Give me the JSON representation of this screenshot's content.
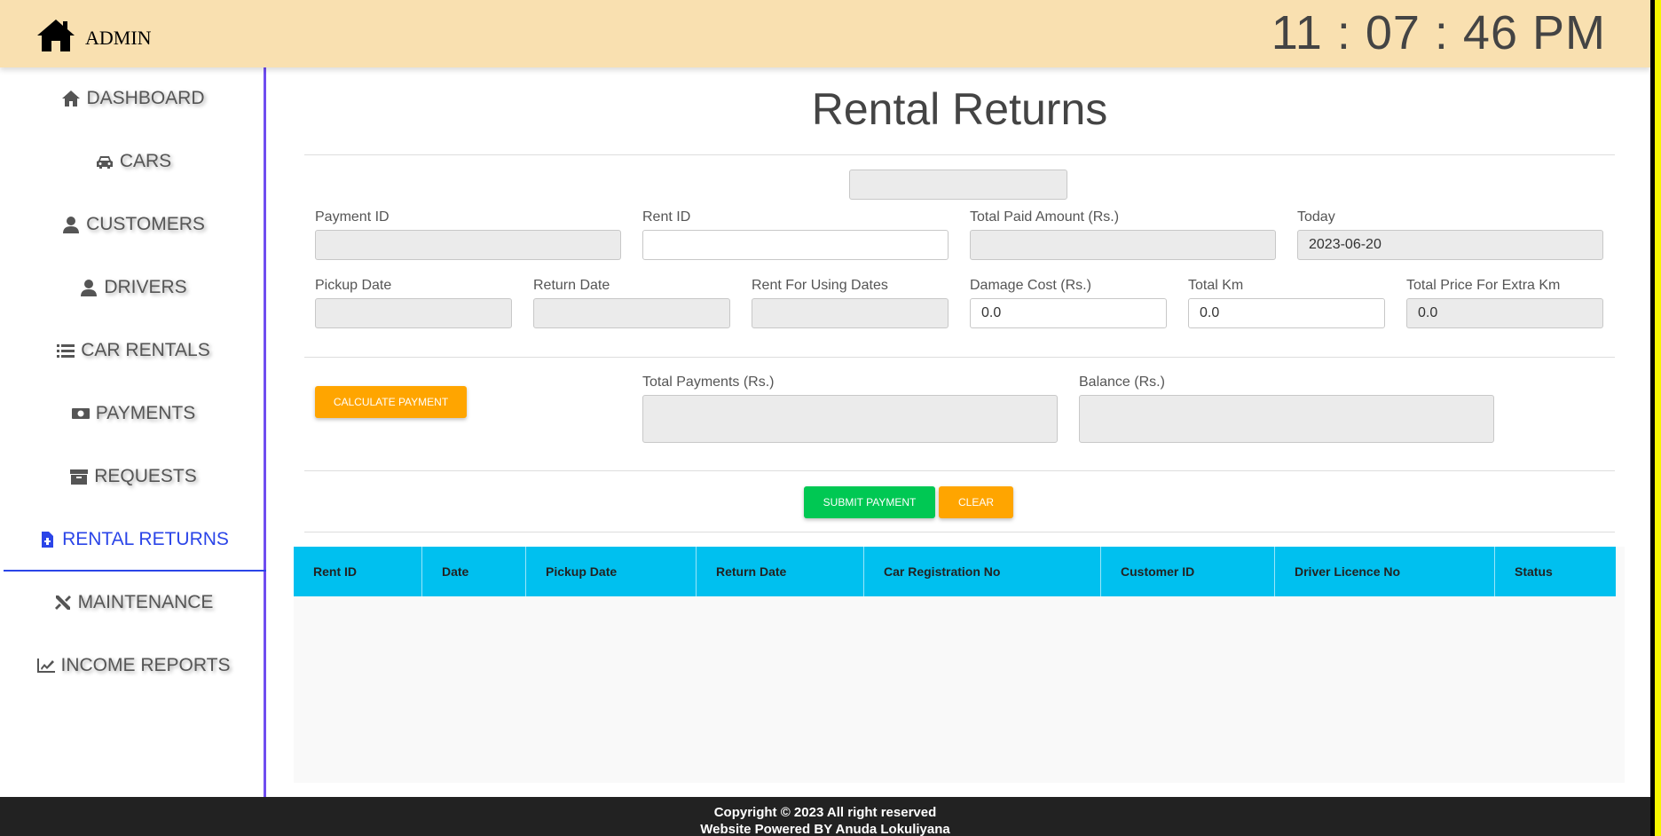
{
  "header": {
    "brand": "ADMIN",
    "clock": "11 : 07 : 46 PM",
    "brand_icon": "home-icon"
  },
  "sidebar": {
    "items": [
      {
        "label": "DASHBOARD",
        "icon": "home-icon"
      },
      {
        "label": "CARS",
        "icon": "car-icon"
      },
      {
        "label": "CUSTOMERS",
        "icon": "user-icon"
      },
      {
        "label": "DRIVERS",
        "icon": "user-icon"
      },
      {
        "label": "CAR RENTALS",
        "icon": "list-icon"
      },
      {
        "label": "PAYMENTS",
        "icon": "money-icon"
      },
      {
        "label": "REQUESTS",
        "icon": "archive-icon"
      },
      {
        "label": "RENTAL RETURNS",
        "icon": "file-invoice-icon",
        "active": true
      },
      {
        "label": "MAINTENANCE",
        "icon": "tools-icon"
      },
      {
        "label": "INCOME REPORTS",
        "icon": "chart-line-icon"
      }
    ],
    "active_color": "#2b45e8"
  },
  "main": {
    "title": "Rental Returns",
    "top_field_value": "",
    "fields": {
      "payment_id": {
        "label": "Payment ID",
        "value": ""
      },
      "rent_id": {
        "label": "Rent ID",
        "value": ""
      },
      "total_paid": {
        "label": "Total Paid Amount (Rs.)",
        "value": ""
      },
      "today": {
        "label": "Today",
        "value": "2023-06-20"
      },
      "pickup_date": {
        "label": "Pickup Date",
        "value": ""
      },
      "return_date": {
        "label": "Return Date",
        "value": ""
      },
      "rent_using_dates": {
        "label": "Rent For Using Dates",
        "value": ""
      },
      "damage_cost": {
        "label": "Damage Cost (Rs.)",
        "value": "0.0"
      },
      "total_km": {
        "label": "Total Km",
        "value": "0.0"
      },
      "extra_km_price": {
        "label": "Total Price For Extra Km",
        "value": "0.0"
      },
      "total_payments": {
        "label": "Total Payments (Rs.)",
        "value": ""
      },
      "balance": {
        "label": "Balance (Rs.)",
        "value": ""
      }
    },
    "buttons": {
      "calculate": "CALCULATE PAYMENT",
      "submit": "SUBMIT PAYMENT",
      "clear": "CLEAR"
    },
    "table": {
      "columns": [
        "Rent ID",
        "Date",
        "Pickup Date",
        "Return Date",
        "Car Registration No",
        "Customer ID",
        "Driver Licence No",
        "Status"
      ],
      "rows": []
    }
  },
  "footer": {
    "line1": "Copyright © 2023 All right reserved",
    "line2": "Website Powered BY Anuda Lokuliyana"
  },
  "colors": {
    "header_bg": "#f9e0b0",
    "table_header": "#00c0ef",
    "button_orange": "#ffa500",
    "button_green": "#00c853",
    "footer_bg": "#222222"
  }
}
